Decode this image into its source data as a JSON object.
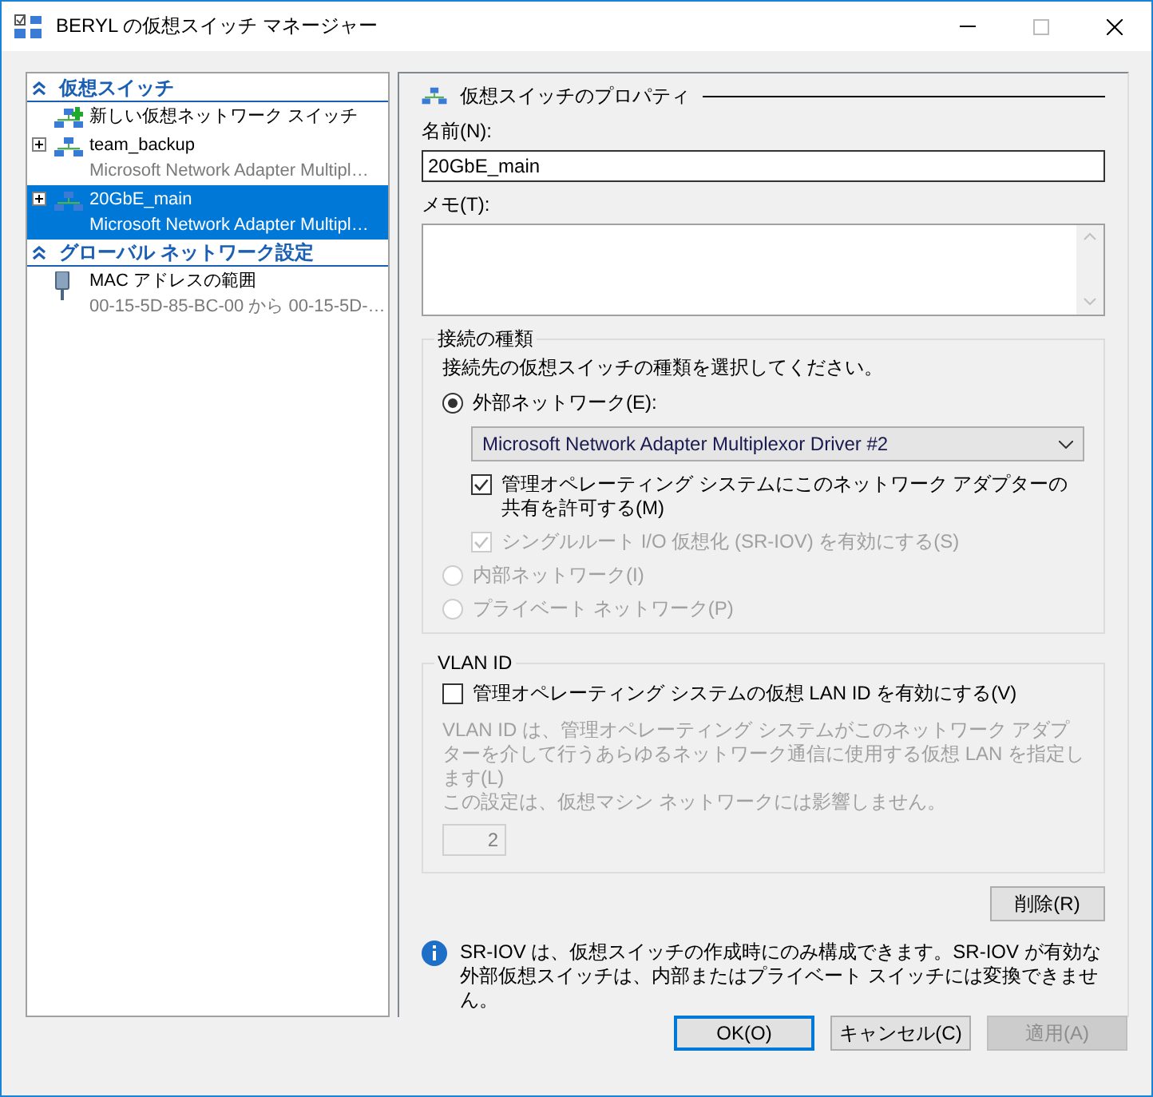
{
  "window": {
    "title": "BERYL の仮想スイッチ マネージャー"
  },
  "sidebar": {
    "sections": [
      {
        "title": "仮想スイッチ",
        "expanded": true,
        "items": [
          {
            "kind": "new",
            "label": "新しい仮想ネットワーク スイッチ",
            "selected": false
          },
          {
            "kind": "switch",
            "label": "team_backup",
            "detail": "Microsoft Network Adapter Multipl…",
            "selected": false
          },
          {
            "kind": "switch",
            "label": "20GbE_main",
            "detail": "Microsoft Network Adapter Multipl…",
            "selected": true
          }
        ]
      },
      {
        "title": "グローバル ネットワーク設定",
        "expanded": true,
        "items": [
          {
            "kind": "mac",
            "label": "MAC アドレスの範囲",
            "detail": "00-15-5D-85-BC-00 から 00-15-5D-…",
            "selected": false
          }
        ]
      }
    ]
  },
  "properties": {
    "heading": "仮想スイッチのプロパティ",
    "name_label": "名前(N):",
    "name_value": "20GbE_main",
    "notes_label": "メモ(T):",
    "connection_type": {
      "title": "接続の種類",
      "prompt": "接続先の仮想スイッチの種類を選択してください。",
      "options": [
        {
          "label": "外部ネットワーク(E):",
          "selected": true,
          "disabled": false
        },
        {
          "label": "内部ネットワーク(I)",
          "selected": false,
          "disabled": true
        },
        {
          "label": "プライベート ネットワーク(P)",
          "selected": false,
          "disabled": true
        }
      ],
      "adapter": "Microsoft Network Adapter Multiplexor Driver #2",
      "checks": [
        {
          "label": "管理オペレーティング システムにこのネットワーク アダプターの共有を許可する(M)",
          "checked": true,
          "disabled": false
        },
        {
          "label": "シングルルート I/O 仮想化 (SR-IOV) を有効にする(S)",
          "checked": true,
          "disabled": true
        }
      ]
    },
    "vlan": {
      "title": "VLAN ID",
      "check": {
        "label": "管理オペレーティング システムの仮想 LAN ID を有効にする(V)",
        "checked": false,
        "disabled": false
      },
      "description": [
        "VLAN ID は、管理オペレーティング システムがこのネットワーク アダプターを介して行うあらゆるネットワーク通信に使用する仮想 LAN を指定します(L)",
        "この設定は、仮想マシン ネットワークには影響しません。"
      ],
      "value": "2",
      "disabled": true
    },
    "remove_button": "削除(R)",
    "info": "SR-IOV は、仮想スイッチの作成時にのみ構成できます。SR-IOV が有効な外部仮想スイッチは、内部またはプライベート スイッチには変換できません。"
  },
  "buttons": [
    {
      "label": "OK(O)",
      "default": true,
      "disabled": false
    },
    {
      "label": "キャンセル(C)",
      "default": false,
      "disabled": false
    },
    {
      "label": "適用(A)",
      "default": false,
      "disabled": true
    }
  ]
}
